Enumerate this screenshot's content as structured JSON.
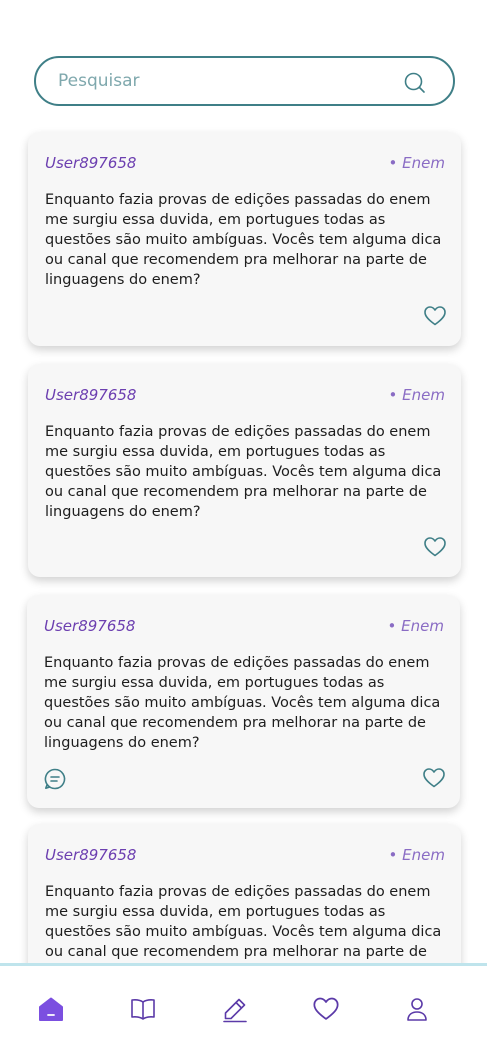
{
  "search": {
    "placeholder": "Pesquisar",
    "value": ""
  },
  "posts": [
    {
      "user": "User897658",
      "tag": "• Enem",
      "body": "Enquanto fazia provas de edições passadas do enem me surgiu essa duvida, em portugues todas as questões são muito ambíguas. Vocês tem alguma dica ou canal que recomendem pra melhorar na parte de linguagens do enem?"
    },
    {
      "user": "User897658",
      "tag": "• Enem",
      "body": "Enquanto fazia provas de edições passadas do enem me surgiu essa duvida, em portugues todas as questões são muito ambíguas. Vocês tem alguma dica ou canal que recomendem pra melhorar na parte de linguagens do enem?"
    },
    {
      "user": "User897658",
      "tag": "• Enem",
      "body": "Enquanto fazia provas de edições passadas do enem me surgiu essa duvida, em portugues todas as questões são muito ambíguas. Vocês tem alguma dica ou canal que recomendem pra melhorar na parte de linguagens do enem?"
    },
    {
      "user": "User897658",
      "tag": "• Enem",
      "body": "Enquanto fazia provas de edições passadas do enem me surgiu essa duvida, em portugues todas as questões são muito ambíguas. Vocês tem alguma dica ou canal que recomendem pra melhorar na parte de linguagens"
    }
  ],
  "nav": {
    "items": [
      "home-icon",
      "book-icon",
      "pencil-icon",
      "heart-icon",
      "user-icon"
    ],
    "active": "home-icon"
  },
  "colors": {
    "accent_teal": "#3f7f87",
    "accent_purple": "#6c3fb0",
    "nav_border": "#bfe4ec"
  }
}
